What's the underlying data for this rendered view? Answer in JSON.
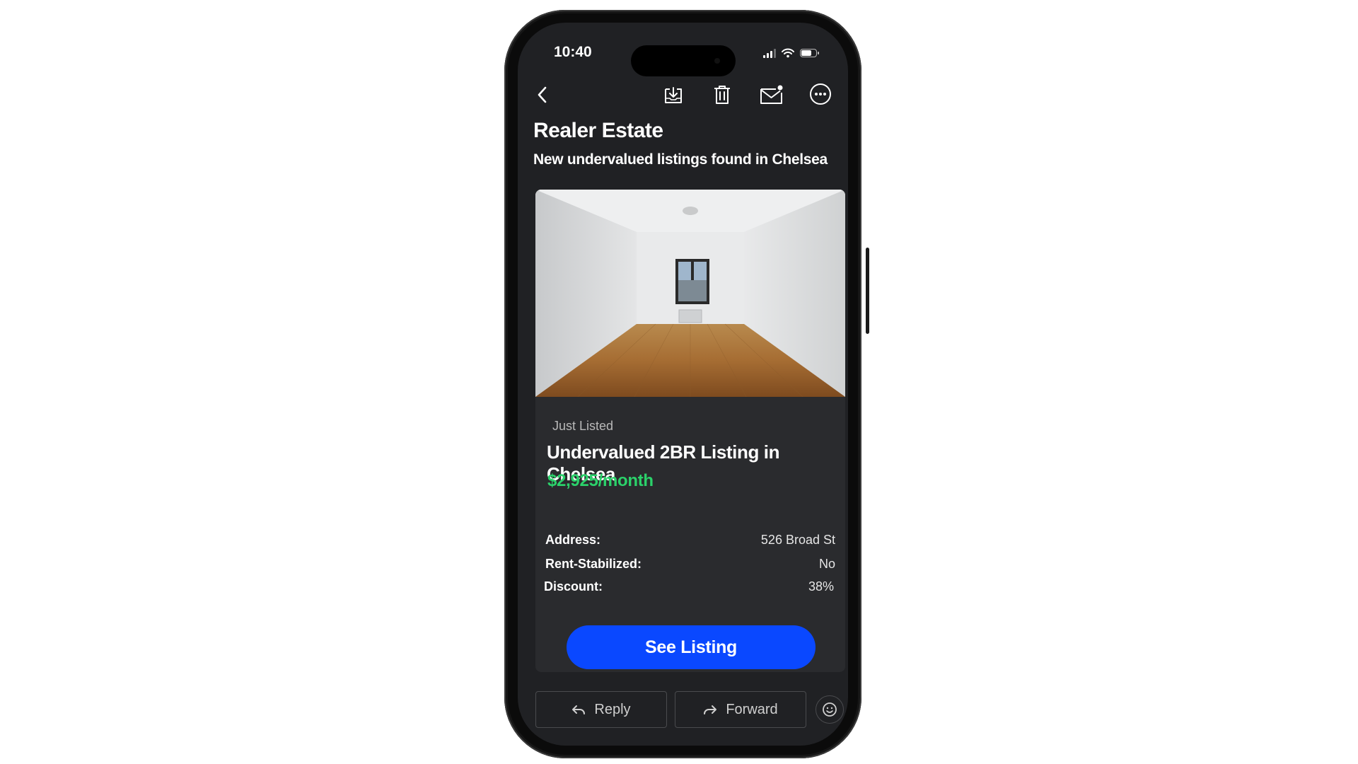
{
  "background_text": {
    "right": "",
    "left": ""
  },
  "status_bar": {
    "time": "10:40"
  },
  "toolbar": {
    "back_icon": "chevron-left-icon",
    "archive_icon": "archive-download-icon",
    "delete_icon": "trash-icon",
    "mark_unread_icon": "mail-unread-icon",
    "more_icon": "more-horizontal-icon"
  },
  "email": {
    "sender": "Realer Estate",
    "subject": "New undervalued listings found in Chelsea"
  },
  "listing": {
    "tag": "Just Listed",
    "title": "Undervalued 2BR Listing in Chelsea",
    "price": "$2,925/month",
    "details": [
      {
        "label": "Address:",
        "value": "526 Broad St"
      },
      {
        "label": "Rent-Stabilized:",
        "value": "No"
      },
      {
        "label": "Discount:",
        "value": "38%"
      }
    ],
    "cta_label": "See Listing"
  },
  "actions": {
    "reply_label": "Reply",
    "forward_label": "Forward"
  },
  "colors": {
    "accent": "#0a48ff",
    "price": "#2bd16a",
    "screen_bg": "#202124",
    "card_bg": "#2a2b2e"
  }
}
